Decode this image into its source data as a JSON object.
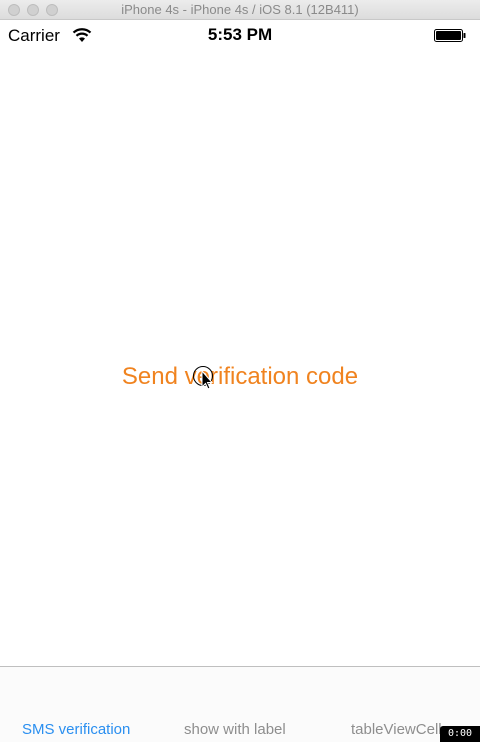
{
  "window": {
    "title": "iPhone 4s - iPhone 4s / iOS 8.1 (12B411)"
  },
  "status_bar": {
    "carrier": "Carrier",
    "time": "5:53 PM"
  },
  "main": {
    "send_button_label": "Send verification code"
  },
  "tab_bar": {
    "tabs": [
      {
        "label": "SMS verification",
        "active": true
      },
      {
        "label": "show with label",
        "active": false
      },
      {
        "label": "tableViewCell",
        "active": false
      }
    ]
  },
  "recorder": {
    "timer": "0:00"
  },
  "colors": {
    "accent_orange": "#f0831f",
    "tab_active": "#2a8ff0",
    "tab_inactive": "#8e8e8e"
  }
}
